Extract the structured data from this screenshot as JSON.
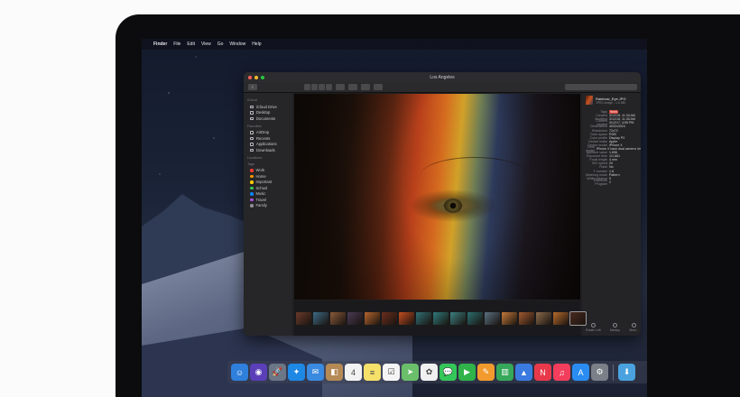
{
  "menubar": {
    "apple": "",
    "app": "Finder",
    "items": [
      "File",
      "Edit",
      "View",
      "Go",
      "Window",
      "Help"
    ]
  },
  "window": {
    "title": "Los Angeles",
    "traffic_colors": [
      "#ff5f57",
      "#febc2e",
      "#28c840"
    ]
  },
  "sidebar": {
    "sections": [
      {
        "heading": "iCloud",
        "items": [
          {
            "label": "iCloud Drive",
            "icon": "cloud-icon"
          },
          {
            "label": "Desktop",
            "icon": "desktop-icon"
          },
          {
            "label": "Documents",
            "icon": "document-icon"
          }
        ]
      },
      {
        "heading": "Favorites",
        "items": [
          {
            "label": "AirDrop",
            "icon": "airdrop-icon"
          },
          {
            "label": "Recents",
            "icon": "clock-icon"
          },
          {
            "label": "Applications",
            "icon": "applications-icon"
          },
          {
            "label": "Downloads",
            "icon": "download-icon"
          }
        ]
      },
      {
        "heading": "Locations",
        "items": []
      }
    ],
    "tags_heading": "Tags",
    "tags": [
      {
        "label": "Work",
        "color": "#ff3b30"
      },
      {
        "label": "Home",
        "color": "#ff9500"
      },
      {
        "label": "Important",
        "color": "#ffcc00"
      },
      {
        "label": "School",
        "color": "#34c759"
      },
      {
        "label": "Music",
        "color": "#0a84ff"
      },
      {
        "label": "Travel",
        "color": "#af52de"
      },
      {
        "label": "Family",
        "color": "#8e8e93"
      }
    ]
  },
  "inspector": {
    "filename": "Rainbow_Eye.JPG",
    "kind": "JPEG image - 1.6 MB",
    "rows": [
      {
        "k": "Tags",
        "v": "Work",
        "badge": true
      },
      {
        "k": "Created",
        "v": "3/12/18, 11:34 AM"
      },
      {
        "k": "Modified",
        "v": "3/12/18, 11:35 AM"
      },
      {
        "k": "Content created",
        "v": "3/12/17, 4:55 PM"
      },
      {
        "k": "Dimensions",
        "v": "4032x3024"
      },
      {
        "k": "Resolution",
        "v": "72x72"
      },
      {
        "k": "Color space",
        "v": "RGB"
      },
      {
        "k": "Color profile",
        "v": "Display P3"
      },
      {
        "k": "Device make",
        "v": "Apple"
      },
      {
        "k": "Device model",
        "v": "iPhone X"
      },
      {
        "k": "Lens model",
        "v": "iPhone X back dual camera 4mm f/1.8"
      },
      {
        "k": "Aperture value",
        "v": "1.696"
      },
      {
        "k": "Exposure time",
        "v": "1/1,661"
      },
      {
        "k": "Focal length",
        "v": "4 mm"
      },
      {
        "k": "ISO speed",
        "v": "20"
      },
      {
        "k": "Flash",
        "v": "No"
      },
      {
        "k": "F number",
        "v": "1.8"
      },
      {
        "k": "Metering mode",
        "v": "Pattern"
      },
      {
        "k": "White balance",
        "v": "0"
      },
      {
        "k": "Exposure Program",
        "v": "2"
      }
    ],
    "actions": [
      "Rotate Left",
      "Markup",
      "More..."
    ]
  },
  "filmstrip": {
    "thumbs": [
      "#6b3a2a",
      "#3c6a85",
      "#8a5a3a",
      "#4a3a55",
      "#b4652d",
      "#6a2e1e",
      "#c24d1f",
      "#2f6f74",
      "#2e7a7a",
      "#3b8080",
      "#2a6e6e",
      "#5a7080",
      "#c37a3a",
      "#a05a30",
      "#8a6a4a",
      "#b76a2c",
      "#4a2a1e"
    ],
    "selected_index": 16
  },
  "dock": {
    "apps": [
      {
        "name": "finder-icon",
        "color": "#2f7fdc",
        "glyph": "☺"
      },
      {
        "name": "siri-icon",
        "color": "#5a3fb8",
        "glyph": "◉"
      },
      {
        "name": "launchpad-icon",
        "color": "#6b7686",
        "glyph": "🚀"
      },
      {
        "name": "safari-icon",
        "color": "#1e88e5",
        "glyph": "✦"
      },
      {
        "name": "mail-icon",
        "color": "#3a8ae0",
        "glyph": "✉"
      },
      {
        "name": "contacts-icon",
        "color": "#b58a55",
        "glyph": "◧"
      },
      {
        "name": "calendar-icon",
        "color": "#f2f2f2",
        "glyph": "4"
      },
      {
        "name": "notes-icon",
        "color": "#f5e06a",
        "glyph": "≡"
      },
      {
        "name": "reminders-icon",
        "color": "#f5f5f5",
        "glyph": "☑"
      },
      {
        "name": "maps-icon",
        "color": "#6bbf6a",
        "glyph": "➤"
      },
      {
        "name": "photos-icon",
        "color": "#f0f0f0",
        "glyph": "✿"
      },
      {
        "name": "messages-icon",
        "color": "#34c759",
        "glyph": "💬"
      },
      {
        "name": "facetime-icon",
        "color": "#2fb34a",
        "glyph": "▶"
      },
      {
        "name": "pages-icon",
        "color": "#f29a2e",
        "glyph": "✎"
      },
      {
        "name": "numbers-icon",
        "color": "#36a85a",
        "glyph": "▥"
      },
      {
        "name": "keynote-icon",
        "color": "#3b7be0",
        "glyph": "▲"
      },
      {
        "name": "news-icon",
        "color": "#e8394a",
        "glyph": "N"
      },
      {
        "name": "music-icon",
        "color": "#f23e5c",
        "glyph": "♫"
      },
      {
        "name": "app-store-icon",
        "color": "#2a8cf0",
        "glyph": "A"
      },
      {
        "name": "system-preferences-icon",
        "color": "#7a7f88",
        "glyph": "⚙"
      },
      {
        "name": "downloads-folder-icon",
        "color": "#4aa3df",
        "glyph": "⬇"
      }
    ]
  }
}
